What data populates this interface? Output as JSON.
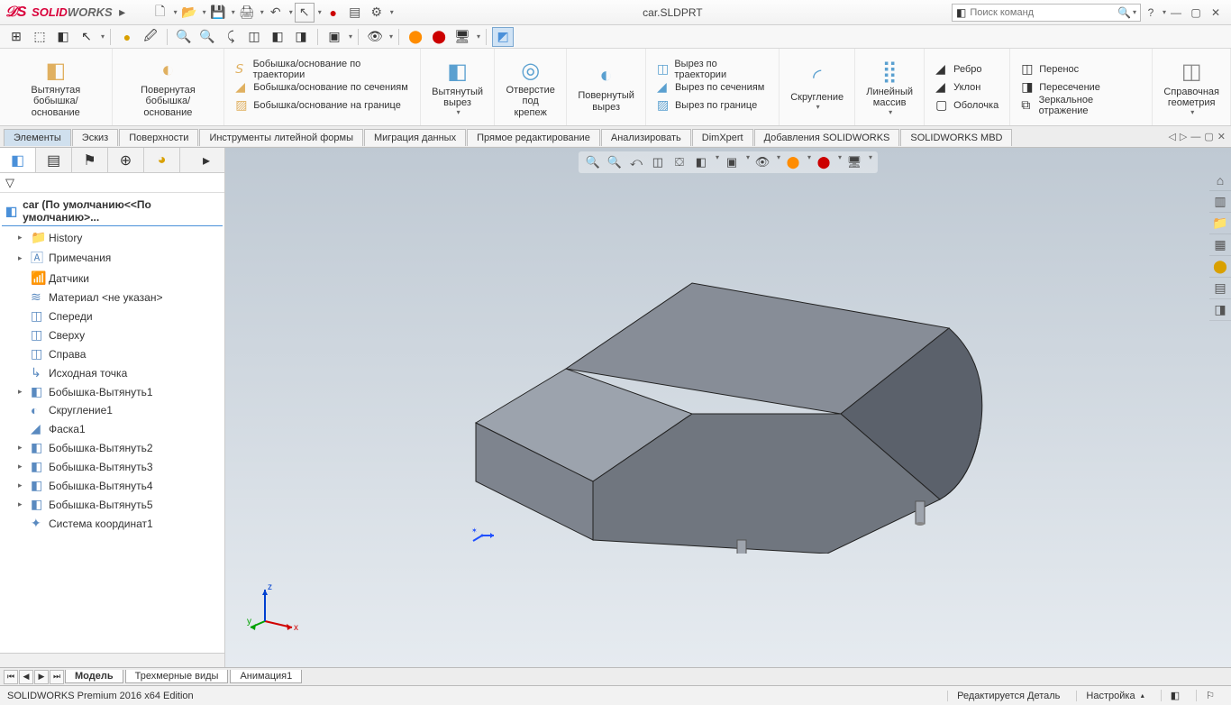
{
  "title": {
    "brand1": "SOLID",
    "brand2": "WORKS",
    "document": "car.SLDPRT"
  },
  "search": {
    "placeholder": "Поиск команд"
  },
  "ribbon": {
    "groups": {
      "extrude": "Вытянутая\nбобышка/основание",
      "revolve": "Повернутая\nбобышка/основание",
      "swept": "Бобышка/основание по траектории",
      "loft": "Бобышка/основание по сечениям",
      "boundary": "Бобышка/основание на границе",
      "extrude_cut": "Вытянутый\nвырез",
      "hole": "Отверстие\nпод крепеж",
      "revolve_cut": "Повернутый\nвырез",
      "swept_cut": "Вырез по траектории",
      "loft_cut": "Вырез по сечениям",
      "boundary_cut": "Вырез по границе",
      "fillet": "Скругление",
      "pattern": "Линейный\nмассив",
      "rib": "Ребро",
      "draft": "Уклон",
      "shell": "Оболочка",
      "intersect": "Перенос",
      "mirror_intersect": "Пересечение",
      "mirror": "Зеркальное отражение",
      "refgeom": "Справочная\nгеометрия"
    }
  },
  "cmd_tabs": [
    "Элементы",
    "Эскиз",
    "Поверхности",
    "Инструменты литейной формы",
    "Миграция данных",
    "Прямое редактирование",
    "Анализировать",
    "DimXpert",
    "Добавления SOLIDWORKS",
    "SOLIDWORKS MBD"
  ],
  "tree": {
    "root": "car  (По умолчанию<<По умолчанию>...",
    "items": [
      {
        "exp": "▸",
        "icon": "📁",
        "label": "History"
      },
      {
        "exp": "▸",
        "icon": "🄰",
        "label": "Примечания"
      },
      {
        "exp": "",
        "icon": "📶",
        "label": "Датчики"
      },
      {
        "exp": "",
        "icon": "≋",
        "label": "Материал <не указан>"
      },
      {
        "exp": "",
        "icon": "◫",
        "label": "Спереди"
      },
      {
        "exp": "",
        "icon": "◫",
        "label": "Сверху"
      },
      {
        "exp": "",
        "icon": "◫",
        "label": "Справа"
      },
      {
        "exp": "",
        "icon": "↳",
        "label": "Исходная точка"
      },
      {
        "exp": "▸",
        "icon": "◧",
        "label": "Бобышка-Вытянуть1"
      },
      {
        "exp": "",
        "icon": "◐",
        "label": "Скругление1"
      },
      {
        "exp": "",
        "icon": "◢",
        "label": "Фаска1"
      },
      {
        "exp": "▸",
        "icon": "◧",
        "label": "Бобышка-Вытянуть2"
      },
      {
        "exp": "▸",
        "icon": "◧",
        "label": "Бобышка-Вытянуть3"
      },
      {
        "exp": "▸",
        "icon": "◧",
        "label": "Бобышка-Вытянуть4"
      },
      {
        "exp": "▸",
        "icon": "◧",
        "label": "Бобышка-Вытянуть5"
      },
      {
        "exp": "",
        "icon": "✦",
        "label": "Система координат1"
      }
    ]
  },
  "bottom_tabs": [
    "Модель",
    "Трехмерные виды",
    "Анимация1"
  ],
  "status": {
    "edition": "SOLIDWORKS Premium 2016 x64 Edition",
    "mode": "Редактируется Деталь",
    "custom": "Настройка"
  },
  "triad": {
    "x": "x",
    "y": "y",
    "z": "z"
  }
}
